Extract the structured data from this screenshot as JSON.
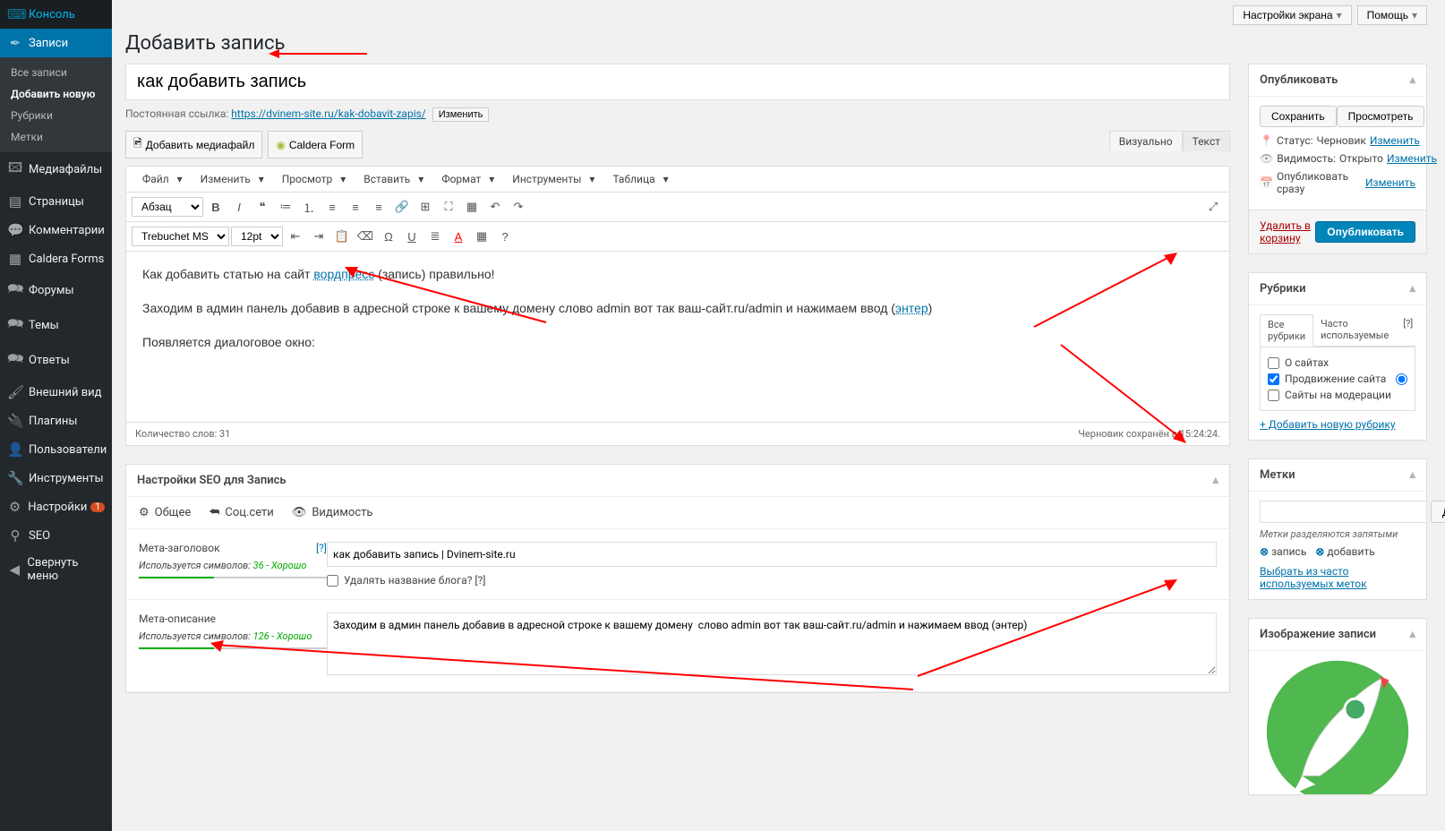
{
  "topbar": {
    "screenOptions": "Настройки экрана",
    "help": "Помощь"
  },
  "pageTitle": "Добавить запись",
  "sidebar": {
    "items": [
      {
        "label": "Консоль"
      },
      {
        "label": "Записи",
        "active": true
      },
      {
        "label": "Медиафайлы"
      },
      {
        "label": "Страницы"
      },
      {
        "label": "Комментарии"
      },
      {
        "label": "Caldera Forms"
      },
      {
        "label": "Форумы"
      },
      {
        "label": "Темы"
      },
      {
        "label": "Ответы"
      },
      {
        "label": "Внешний вид"
      },
      {
        "label": "Плагины"
      },
      {
        "label": "Пользователи"
      },
      {
        "label": "Инструменты"
      },
      {
        "label": "Настройки",
        "badge": "1"
      },
      {
        "label": "SEO"
      },
      {
        "label": "Свернуть меню"
      }
    ],
    "sub": [
      {
        "label": "Все записи"
      },
      {
        "label": "Добавить новую",
        "bold": true
      },
      {
        "label": "Рубрики"
      },
      {
        "label": "Метки"
      }
    ]
  },
  "title": "как добавить запись",
  "permalink": {
    "label": "Постоянная ссылка:",
    "url": "https://dvinem-site.ru/kak-dobavit-zapis/",
    "edit": "Изменить"
  },
  "media": {
    "addMedia": "Добавить медиафайл",
    "caldera": "Caldera Form"
  },
  "editorTabs": {
    "visual": "Визуально",
    "text": "Текст"
  },
  "menubar": [
    "Файл",
    "Изменить",
    "Просмотр",
    "Вставить",
    "Формат",
    "Инструменты",
    "Таблица"
  ],
  "toolbar1": {
    "paragraph": "Абзац"
  },
  "toolbar2": {
    "font": "Trebuchet MS",
    "size": "12pt"
  },
  "content": {
    "p1a": "Как добавить статью на сайт ",
    "p1link": "вордпресс",
    "p1b": " (запись) правильно!",
    "p2": "Заходим в админ панель добавив в адресной строке к вашему домену  слово admin вот так ваш-сайт.ru/admin и нажимаем ввод (",
    "p2link": "энтер",
    "p2end": ")",
    "p3": "Появляется диалоговое окно:"
  },
  "statusbar": {
    "words": "Количество слов: 31",
    "saved": "Черновик сохранён в 15:24:24."
  },
  "seo": {
    "heading": "Настройки SEO для Запись",
    "tabs": {
      "general": "Общее",
      "social": "Соц.сети",
      "visibility": "Видимость"
    },
    "metaTitle": {
      "label": "Мета-заголовок",
      "help": "[?]",
      "sub": "Используется символов:",
      "count": "36 - Хорошо",
      "value": "как добавить запись | Dvinem-site.ru",
      "removeBlog": "Удалять название блога? [?]"
    },
    "metaDesc": {
      "label": "Мета-описание",
      "sub": "Используется символов:",
      "count": "126 - Хорошо",
      "value": "Заходим в админ панель добавив в адресной строке к вашему домену  слово admin вот так ваш-сайт.ru/admin и нажимаем ввод (энтер)"
    }
  },
  "publish": {
    "heading": "Опубликовать",
    "save": "Сохранить",
    "preview": "Просмотреть",
    "status": {
      "label": "Статус:",
      "value": "Черновик",
      "edit": "Изменить"
    },
    "visibility": {
      "label": "Видимость:",
      "value": "Открыто",
      "edit": "Изменить"
    },
    "schedule": {
      "label": "Опубликовать сразу",
      "edit": "Изменить"
    },
    "trash": "Удалить в корзину",
    "submit": "Опубликовать"
  },
  "categories": {
    "heading": "Рубрики",
    "tabAll": "Все рубрики",
    "tabUsed": "Часто используемые",
    "help": "[?]",
    "items": [
      {
        "label": "О сайтах",
        "checked": false
      },
      {
        "label": "Продвижение сайта",
        "checked": true,
        "primary": true
      },
      {
        "label": "Сайты на модерации",
        "checked": false
      }
    ],
    "add": "+ Добавить новую рубрику"
  },
  "tags": {
    "heading": "Метки",
    "add": "Добавить",
    "hint": "Метки разделяются запятыми",
    "chips": [
      "запись",
      "добавить"
    ],
    "choose": "Выбрать из часто используемых меток"
  },
  "featured": {
    "heading": "Изображение записи"
  }
}
